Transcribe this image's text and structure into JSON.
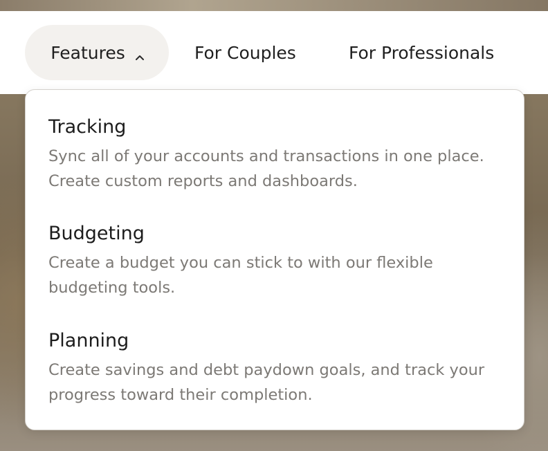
{
  "nav": {
    "items": [
      {
        "label": "Features",
        "expanded": true,
        "icon": "chevron-up-icon"
      },
      {
        "label": "For Couples"
      },
      {
        "label": "For Professionals"
      }
    ]
  },
  "dropdown": {
    "items": [
      {
        "title": "Tracking",
        "description": "Sync all of your accounts and transactions in one place. Create custom reports and dashboards."
      },
      {
        "title": "Budgeting",
        "description": "Create a budget you can stick to with our flexible budgeting tools."
      },
      {
        "title": "Planning",
        "description": "Create savings and debt paydown goals, and track your progress toward their completion."
      }
    ]
  },
  "colors": {
    "active_pill_bg": "#f3f1ee",
    "text_primary": "#1c1c1c",
    "text_secondary": "#7c7975",
    "panel_border": "#d4d1cc"
  }
}
